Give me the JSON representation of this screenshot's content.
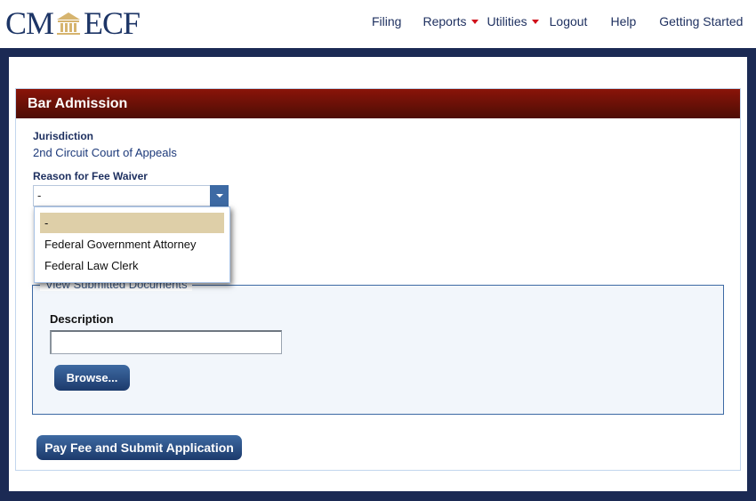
{
  "header": {
    "logo_left": "CM",
    "logo_right": "ECF",
    "nav": [
      {
        "label": "Filing",
        "has_dropdown": false
      },
      {
        "label": "Reports",
        "has_dropdown": true
      },
      {
        "label": "Utilities",
        "has_dropdown": true
      },
      {
        "label": "Logout",
        "has_dropdown": false
      },
      {
        "label": "Help",
        "has_dropdown": false
      },
      {
        "label": "Getting Started",
        "has_dropdown": false
      }
    ]
  },
  "panel": {
    "title": "Bar Admission",
    "jurisdiction_label": "Jurisdiction",
    "jurisdiction_value": "2nd Circuit Court of Appeals",
    "fee_waiver_label": "Reason for Fee Waiver",
    "fee_waiver_selected": "-",
    "fee_waiver_options": [
      "-",
      "Federal Government Attorney",
      "Federal Law Clerk"
    ],
    "documents_legend": "View Submitted Documents",
    "description_label": "Description",
    "description_value": "",
    "browse_label": "Browse...",
    "submit_label": "Pay Fee and Submit Application"
  },
  "colors": {
    "brand_navy": "#1b2a54",
    "header_red": "#8a1409",
    "button_blue": "#2c5087",
    "dropdown_highlight": "#decfa8",
    "caret_red": "#d0101a"
  }
}
